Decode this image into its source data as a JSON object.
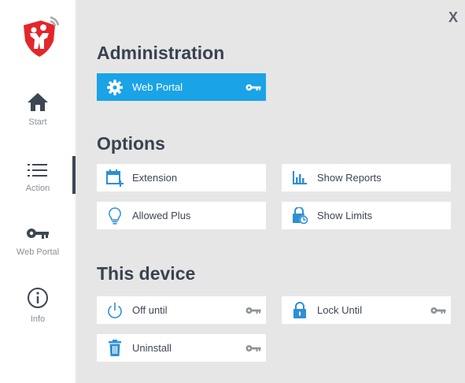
{
  "sidebar": {
    "items": [
      {
        "label": "Start",
        "icon": "home-icon"
      },
      {
        "label": "Action",
        "icon": "list-icon"
      },
      {
        "label": "Web Portal",
        "icon": "key-icon"
      },
      {
        "label": "Info",
        "icon": "info-icon"
      }
    ],
    "active_index": 1
  },
  "close_label": "X",
  "sections": {
    "administration": {
      "title": "Administration",
      "items": [
        {
          "label": "Web Portal",
          "icon": "gear-icon",
          "locked": true,
          "active": true
        }
      ]
    },
    "options": {
      "title": "Options",
      "items": [
        {
          "label": "Extension",
          "icon": "calendar-add-icon"
        },
        {
          "label": "Show Reports",
          "icon": "bar-chart-icon"
        },
        {
          "label": "Allowed Plus",
          "icon": "lightbulb-icon"
        },
        {
          "label": "Show Limits",
          "icon": "lock-clock-icon"
        }
      ]
    },
    "device": {
      "title": "This device",
      "items": [
        {
          "label": "Off until",
          "icon": "power-icon",
          "locked": true
        },
        {
          "label": "Lock Until",
          "icon": "padlock-icon",
          "locked": true
        },
        {
          "label": "Uninstall",
          "icon": "trash-icon",
          "locked": true
        }
      ]
    }
  },
  "colors": {
    "accent": "#1aa3e6",
    "icon_blue": "#2d8fd5",
    "background": "#e6e6e6",
    "text_dark": "#3a4250",
    "logo_red": "#e3262b"
  }
}
